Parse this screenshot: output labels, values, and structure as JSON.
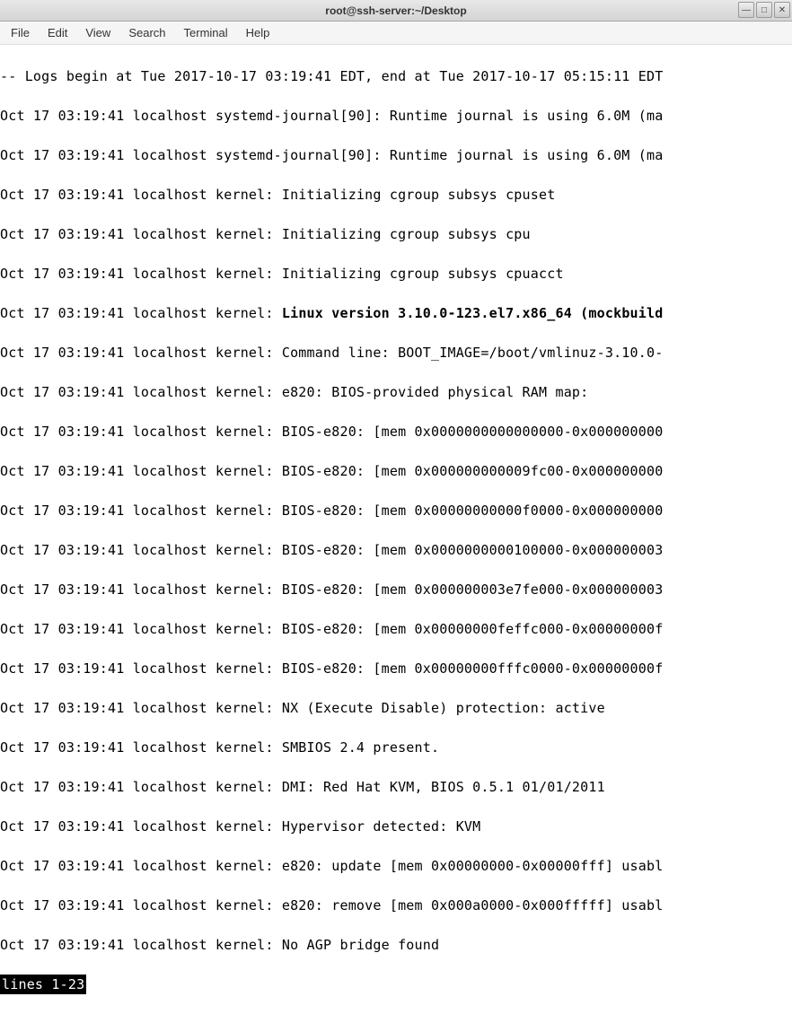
{
  "window": {
    "title": "root@ssh-server:~/Desktop"
  },
  "menu": {
    "file": "File",
    "edit": "Edit",
    "view": "View",
    "search": "Search",
    "terminal": "Terminal",
    "help": "Help"
  },
  "log": {
    "header": "-- Logs begin at Tue 2017-10-17 03:19:41 EDT, end at Tue 2017-10-17 05:15:11 EDT",
    "l1": "Oct 17 03:19:41 localhost systemd-journal[90]: Runtime journal is using 6.0M (ma",
    "l2": "Oct 17 03:19:41 localhost systemd-journal[90]: Runtime journal is using 6.0M (ma",
    "l3": "Oct 17 03:19:41 localhost kernel: Initializing cgroup subsys cpuset",
    "l4": "Oct 17 03:19:41 localhost kernel: Initializing cgroup subsys cpu",
    "l5": "Oct 17 03:19:41 localhost kernel: Initializing cgroup subsys cpuacct",
    "l6a": "Oct 17 03:19:41 localhost kernel: ",
    "l6b": "Linux version 3.10.0-123.el7.x86_64 (mockbuild",
    "l7": "Oct 17 03:19:41 localhost kernel: Command line: BOOT_IMAGE=/boot/vmlinuz-3.10.0-",
    "l8": "Oct 17 03:19:41 localhost kernel: e820: BIOS-provided physical RAM map:",
    "l9": "Oct 17 03:19:41 localhost kernel: BIOS-e820: [mem 0x0000000000000000-0x000000000",
    "l10": "Oct 17 03:19:41 localhost kernel: BIOS-e820: [mem 0x000000000009fc00-0x000000000",
    "l11": "Oct 17 03:19:41 localhost kernel: BIOS-e820: [mem 0x00000000000f0000-0x000000000",
    "l12": "Oct 17 03:19:41 localhost kernel: BIOS-e820: [mem 0x0000000000100000-0x000000003",
    "l13": "Oct 17 03:19:41 localhost kernel: BIOS-e820: [mem 0x000000003e7fe000-0x000000003",
    "l14": "Oct 17 03:19:41 localhost kernel: BIOS-e820: [mem 0x00000000feffc000-0x00000000f",
    "l15": "Oct 17 03:19:41 localhost kernel: BIOS-e820: [mem 0x00000000fffc0000-0x00000000f",
    "l16": "Oct 17 03:19:41 localhost kernel: NX (Execute Disable) protection: active",
    "l17": "Oct 17 03:19:41 localhost kernel: SMBIOS 2.4 present.",
    "l18": "Oct 17 03:19:41 localhost kernel: DMI: Red Hat KVM, BIOS 0.5.1 01/01/2011",
    "l19": "Oct 17 03:19:41 localhost kernel: Hypervisor detected: KVM",
    "l20": "Oct 17 03:19:41 localhost kernel: e820: update [mem 0x00000000-0x00000fff] usabl",
    "l21": "Oct 17 03:19:41 localhost kernel: e820: remove [mem 0x000a0000-0x000fffff] usabl",
    "l22": "Oct 17 03:19:41 localhost kernel: No AGP bridge found",
    "status": "lines 1-23"
  }
}
